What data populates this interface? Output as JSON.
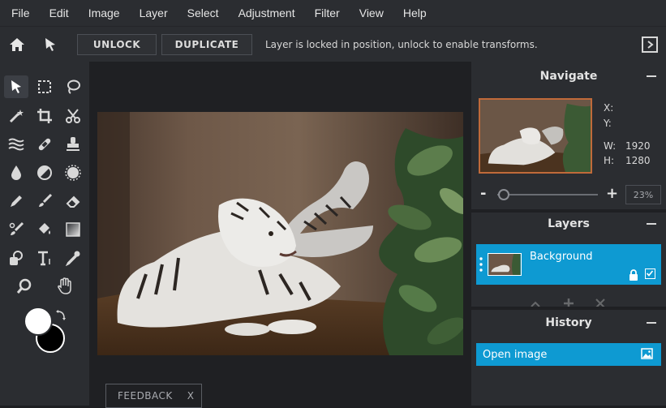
{
  "menu": [
    "File",
    "Edit",
    "Image",
    "Layer",
    "Select",
    "Adjustment",
    "Filter",
    "View",
    "Help"
  ],
  "options": {
    "unlock_label": "UNLOCK",
    "duplicate_label": "DUPLICATE",
    "status": "Layer is locked in position, unlock to enable transforms."
  },
  "tools": [
    "pointer-tool",
    "rect-select-tool",
    "lasso-tool",
    "magic-wand-tool",
    "crop-tool",
    "cut-tool",
    "liquify-tool",
    "healing-tool",
    "clone-stamp-tool",
    "blur-tool",
    "dodge-tool",
    "sponge-tool",
    "pencil-tool",
    "brush-tool",
    "eraser-tool",
    "color-replace-tool",
    "fill-tool",
    "gradient-tool",
    "shape-tool",
    "text-tool",
    "eyedropper-tool",
    "zoom-tool",
    "hand-tool"
  ],
  "colors": {
    "foreground": "#ffffff",
    "background": "#000000",
    "accent": "#0e9ad2"
  },
  "canvas": {
    "feedback_label": "FEEDBACK",
    "feedback_close": "X"
  },
  "navigate": {
    "title": "Navigate",
    "x_label": "X:",
    "x_value": "",
    "y_label": "Y:",
    "y_value": "",
    "w_label": "W:",
    "w_value": "1920",
    "h_label": "H:",
    "h_value": "1280",
    "zoom_minus": "-",
    "zoom_plus": "+",
    "zoom_percent": "23%",
    "zoom_level": 0.23
  },
  "layers": {
    "title": "Layers",
    "items": [
      {
        "name": "Background",
        "locked": true,
        "visible": true
      }
    ]
  },
  "history": {
    "title": "History",
    "items": [
      {
        "label": "Open image"
      }
    ]
  }
}
